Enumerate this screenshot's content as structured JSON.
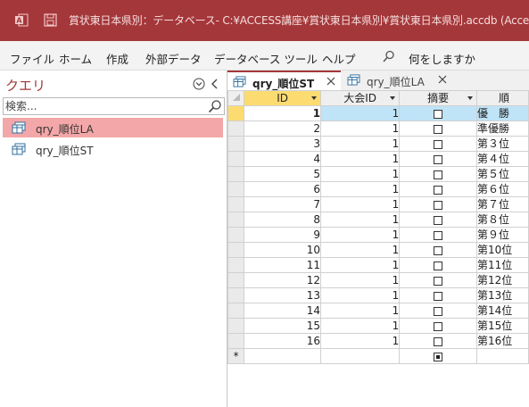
{
  "window": {
    "title": "賞状東日本県別：データベース- C:¥ACCESS講座¥賞状東日本県別¥賞状東日本県別.accdb (Access"
  },
  "ribbon": {
    "tabs": [
      "ファイル",
      "ホーム",
      "作成",
      "外部データ",
      "データベース ツール",
      "ヘルプ"
    ],
    "tell_me": "何をしますか"
  },
  "nav": {
    "title": "クエリ",
    "search_placeholder": "検索...",
    "items": [
      "qry_順位LA",
      "qry_順位ST"
    ]
  },
  "doc_tabs": [
    "qry_順位ST",
    "qry_順位LA"
  ],
  "grid": {
    "columns": [
      "ID",
      "大会ID",
      "摘要",
      "順"
    ],
    "rows": [
      {
        "id": "1",
        "taikai": "1",
        "rank": "優　勝"
      },
      {
        "id": "2",
        "taikai": "1",
        "rank": "準優勝"
      },
      {
        "id": "3",
        "taikai": "1",
        "rank": "第３位"
      },
      {
        "id": "4",
        "taikai": "1",
        "rank": "第４位"
      },
      {
        "id": "5",
        "taikai": "1",
        "rank": "第５位"
      },
      {
        "id": "6",
        "taikai": "1",
        "rank": "第６位"
      },
      {
        "id": "7",
        "taikai": "1",
        "rank": "第７位"
      },
      {
        "id": "8",
        "taikai": "1",
        "rank": "第８位"
      },
      {
        "id": "9",
        "taikai": "1",
        "rank": "第９位"
      },
      {
        "id": "10",
        "taikai": "1",
        "rank": "第10位"
      },
      {
        "id": "11",
        "taikai": "1",
        "rank": "第11位"
      },
      {
        "id": "12",
        "taikai": "1",
        "rank": "第12位"
      },
      {
        "id": "13",
        "taikai": "1",
        "rank": "第13位"
      },
      {
        "id": "14",
        "taikai": "1",
        "rank": "第14位"
      },
      {
        "id": "15",
        "taikai": "1",
        "rank": "第15位"
      },
      {
        "id": "16",
        "taikai": "1",
        "rank": "第16位"
      }
    ],
    "new_row_marker": "*"
  },
  "colors": {
    "accent": "#a4373a",
    "nav_selected": "#f4a7a8",
    "current_row": "#bfe3f7",
    "record_selector_active": "#fcdc70"
  }
}
